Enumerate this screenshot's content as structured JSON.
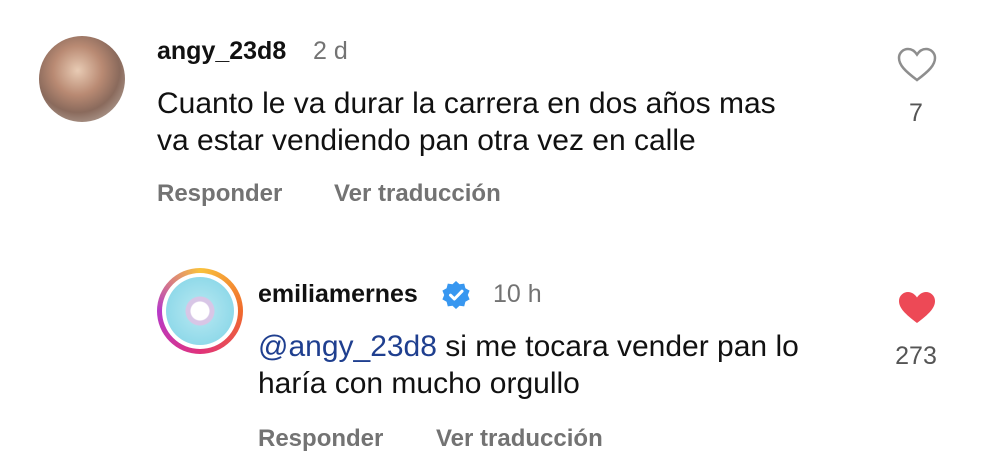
{
  "comments": [
    {
      "username": "angy_23d8",
      "time": "2 d",
      "text_lines": [
        "Cuanto le va durar la carrera en dos años mas",
        "va estar vendiendo pan otra vez en calle"
      ],
      "reply_label": "Responder",
      "translate_label": "Ver traducción",
      "like_count": "7",
      "liked": false
    },
    {
      "username": "emiliamernes",
      "verified": true,
      "time": "10 h",
      "mention": "@angy_23d8",
      "text_line1_rest": " si me tocara vender pan lo",
      "text_line2": "haría con mucho orgullo",
      "reply_label": "Responder",
      "translate_label": "Ver traducción",
      "like_count": "273",
      "liked": true
    }
  ],
  "colors": {
    "liked_heart": "#ed4956",
    "verified_badge": "#3897f0",
    "mention": "#1f3f8f"
  }
}
